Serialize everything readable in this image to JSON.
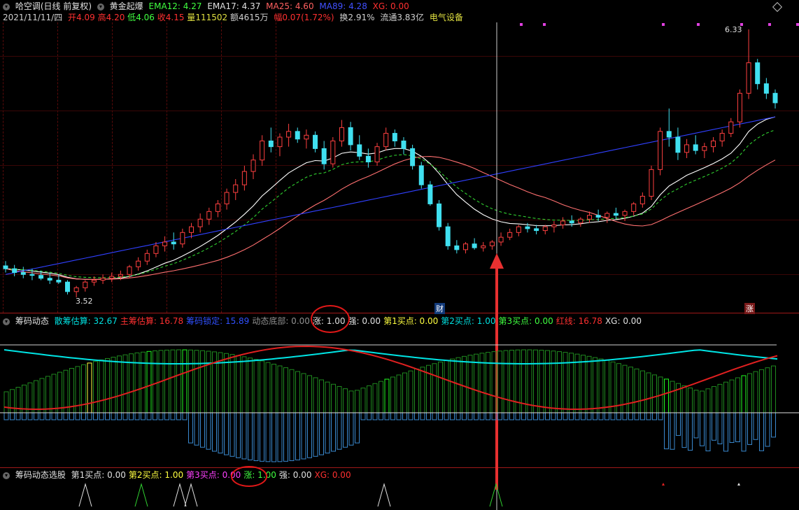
{
  "header": {
    "stock": "哈空调(日线 前复权)",
    "indicator": "黄金起爆",
    "ema12": "EMA12: 4.27",
    "ema17": "EMA17: 4.37",
    "ma25": "MA25: 4.60",
    "ma89": "MA89: 4.28",
    "xg": "XG: 0.00",
    "date": "2021/11/11/四",
    "open_label": "开",
    "open": "4.09",
    "high_label": "高",
    "high": "4.20",
    "low_label": "低",
    "low": "4.06",
    "close_label": "收",
    "close": "4.15",
    "vol_label": "量",
    "vol": "111502",
    "amt": "额4615万",
    "chg_label": "幅",
    "chg": "0.07(1.72%)",
    "turnover": "换2.91%",
    "float": "流通3.83亿",
    "sector": "电气设备"
  },
  "annotations": {
    "max_price": "6.33",
    "min_price": "3.52",
    "cai": "财",
    "zhang": "涨"
  },
  "panel2": {
    "title": "筹码动态",
    "items": [
      {
        "text": "散筹估算: 32.67",
        "color": "#00e0e0"
      },
      {
        "text": "主筹估算: 16.78",
        "color": "#ff3030"
      },
      {
        "text": "筹码锁定: 15.89",
        "color": "#3050ff"
      },
      {
        "text": "动态底部: 0.00",
        "color": "#909090"
      },
      {
        "text": "涨: 1.00",
        "color": "#e0e0e0"
      },
      {
        "text": "强: 0.00",
        "color": "#e0e0e0"
      },
      {
        "text": "第1买点: 0.00",
        "color": "#ffff40"
      },
      {
        "text": "第2买点: 1.00",
        "color": "#00e0e0"
      },
      {
        "text": "第3买点: 0.00",
        "color": "#40ff40"
      },
      {
        "text": "红线: 16.78",
        "color": "#ff3030"
      },
      {
        "text": "XG: 0.00",
        "color": "#e0e0e0"
      }
    ]
  },
  "panel3": {
    "title": "筹码动态选股",
    "items": [
      {
        "text": "第1买点: 0.00",
        "color": "#e0e0e0"
      },
      {
        "text": "第2买点: 1.00",
        "color": "#ffff40"
      },
      {
        "text": "第3买点: 0.00",
        "color": "#ff40ff"
      },
      {
        "text": "涨: 1.00",
        "color": "#40ff40"
      },
      {
        "text": "强: 0.00",
        "color": "#e0e0e0"
      },
      {
        "text": "XG: 0.00",
        "color": "#ff3030"
      }
    ]
  },
  "chart_data": {
    "type": "candlestick",
    "period": "daily",
    "price_range": [
      3.52,
      6.33
    ],
    "candles": [
      [
        3.85,
        3.9,
        3.78,
        3.82
      ],
      [
        3.82,
        3.86,
        3.74,
        3.78
      ],
      [
        3.78,
        3.84,
        3.72,
        3.76
      ],
      [
        3.76,
        3.82,
        3.7,
        3.75
      ],
      [
        3.75,
        3.8,
        3.7,
        3.72
      ],
      [
        3.72,
        3.78,
        3.66,
        3.7
      ],
      [
        3.7,
        3.76,
        3.66,
        3.68
      ],
      [
        3.68,
        3.7,
        3.55,
        3.58
      ],
      [
        3.58,
        3.64,
        3.52,
        3.62
      ],
      [
        3.62,
        3.7,
        3.58,
        3.68
      ],
      [
        3.68,
        3.74,
        3.64,
        3.7
      ],
      [
        3.7,
        3.76,
        3.66,
        3.72
      ],
      [
        3.72,
        3.78,
        3.68,
        3.74
      ],
      [
        3.74,
        3.8,
        3.7,
        3.76
      ],
      [
        3.76,
        3.86,
        3.72,
        3.84
      ],
      [
        3.84,
        3.94,
        3.8,
        3.9
      ],
      [
        3.9,
        4.02,
        3.86,
        3.98
      ],
      [
        3.98,
        4.1,
        3.94,
        4.06
      ],
      [
        4.06,
        4.16,
        4.0,
        4.1
      ],
      [
        4.1,
        4.2,
        4.02,
        4.08
      ],
      [
        4.08,
        4.24,
        4.04,
        4.2
      ],
      [
        4.2,
        4.3,
        4.14,
        4.26
      ],
      [
        4.26,
        4.4,
        4.2,
        4.34
      ],
      [
        4.34,
        4.46,
        4.28,
        4.42
      ],
      [
        4.42,
        4.54,
        4.36,
        4.5
      ],
      [
        4.5,
        4.66,
        4.44,
        4.62
      ],
      [
        4.62,
        4.76,
        4.54,
        4.7
      ],
      [
        4.7,
        4.9,
        4.64,
        4.84
      ],
      [
        4.84,
        5.02,
        4.76,
        4.96
      ],
      [
        4.96,
        5.22,
        4.9,
        5.16
      ],
      [
        5.16,
        5.3,
        5.04,
        5.1
      ],
      [
        5.1,
        5.24,
        5.0,
        5.2
      ],
      [
        5.2,
        5.34,
        5.1,
        5.26
      ],
      [
        5.26,
        5.3,
        5.14,
        5.18
      ],
      [
        5.18,
        5.28,
        5.08,
        5.22
      ],
      [
        5.22,
        5.26,
        5.04,
        5.08
      ],
      [
        5.08,
        5.16,
        4.86,
        4.92
      ],
      [
        4.92,
        5.2,
        4.88,
        5.16
      ],
      [
        5.16,
        5.38,
        5.1,
        5.3
      ],
      [
        5.3,
        5.36,
        5.06,
        5.12
      ],
      [
        5.12,
        5.22,
        4.96,
        5.0
      ],
      [
        5.0,
        5.08,
        4.88,
        4.94
      ],
      [
        4.94,
        5.14,
        4.9,
        5.1
      ],
      [
        5.1,
        5.3,
        5.06,
        5.24
      ],
      [
        5.24,
        5.28,
        5.1,
        5.16
      ],
      [
        5.16,
        5.2,
        5.02,
        5.08
      ],
      [
        5.08,
        5.12,
        4.86,
        4.9
      ],
      [
        4.9,
        4.94,
        4.66,
        4.7
      ],
      [
        4.7,
        4.74,
        4.48,
        4.5
      ],
      [
        4.5,
        4.54,
        4.22,
        4.26
      ],
      [
        4.26,
        4.3,
        4.02,
        4.06
      ],
      [
        4.06,
        4.12,
        3.98,
        4.02
      ],
      [
        4.02,
        4.1,
        3.98,
        4.08
      ],
      [
        4.08,
        4.14,
        4.02,
        4.04
      ],
      [
        4.04,
        4.1,
        4.0,
        4.06
      ],
      [
        4.06,
        4.12,
        4.02,
        4.1
      ],
      [
        4.1,
        4.2,
        4.06,
        4.15
      ],
      [
        4.15,
        4.24,
        4.12,
        4.2
      ],
      [
        4.2,
        4.28,
        4.16,
        4.26
      ],
      [
        4.26,
        4.3,
        4.2,
        4.24
      ],
      [
        4.24,
        4.28,
        4.18,
        4.22
      ],
      [
        4.22,
        4.28,
        4.18,
        4.26
      ],
      [
        4.26,
        4.32,
        4.2,
        4.28
      ],
      [
        4.28,
        4.36,
        4.24,
        4.32
      ],
      [
        4.32,
        4.38,
        4.26,
        4.3
      ],
      [
        4.3,
        4.36,
        4.26,
        4.34
      ],
      [
        4.34,
        4.42,
        4.3,
        4.38
      ],
      [
        4.38,
        4.44,
        4.32,
        4.36
      ],
      [
        4.36,
        4.42,
        4.3,
        4.4
      ],
      [
        4.4,
        4.46,
        4.34,
        4.38
      ],
      [
        4.38,
        4.44,
        4.32,
        4.42
      ],
      [
        4.42,
        4.52,
        4.38,
        4.5
      ],
      [
        4.5,
        4.62,
        4.46,
        4.58
      ],
      [
        4.58,
        4.9,
        4.54,
        4.86
      ],
      [
        4.86,
        5.3,
        4.8,
        5.26
      ],
      [
        5.26,
        5.5,
        5.1,
        5.2
      ],
      [
        5.2,
        5.3,
        4.96,
        5.04
      ],
      [
        5.04,
        5.18,
        4.98,
        5.12
      ],
      [
        5.12,
        5.22,
        5.02,
        5.06
      ],
      [
        5.06,
        5.14,
        4.98,
        5.1
      ],
      [
        5.1,
        5.2,
        5.04,
        5.16
      ],
      [
        5.16,
        5.28,
        5.1,
        5.24
      ],
      [
        5.24,
        5.4,
        5.2,
        5.36
      ],
      [
        5.36,
        5.7,
        5.3,
        5.66
      ],
      [
        5.66,
        6.33,
        5.6,
        5.98
      ],
      [
        5.98,
        6.02,
        5.7,
        5.76
      ],
      [
        5.76,
        5.82,
        5.6,
        5.66
      ],
      [
        5.66,
        5.7,
        5.5,
        5.56
      ]
    ],
    "series": [
      {
        "name": "EMA12",
        "color": "#ffffff"
      },
      {
        "name": "EMA17",
        "color": "#00ff00"
      },
      {
        "name": "MA25",
        "color": "#ff6060"
      },
      {
        "name": "MA89",
        "color": "#4050ff"
      }
    ]
  }
}
